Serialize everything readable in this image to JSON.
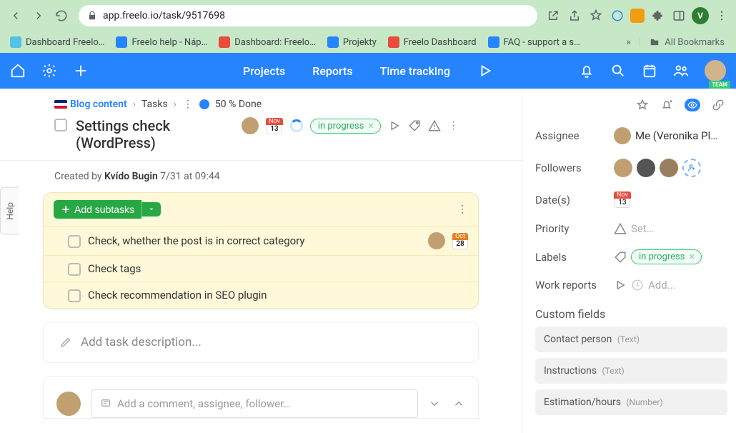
{
  "browser": {
    "url": "app.freelo.io/task/9517698",
    "avatar_letter": "V",
    "bookmarks": [
      {
        "label": "Dashboard Freelo…",
        "fav": "#2684ff"
      },
      {
        "label": "Freelo help - Náp…",
        "fav": "#2684ff"
      },
      {
        "label": "Dashboard: Freelo…",
        "fav": "#e74c3c"
      },
      {
        "label": "Projekty",
        "fav": "#2684ff"
      },
      {
        "label": "Freelo Dashboard",
        "fav": "#e74c3c"
      },
      {
        "label": "FAQ - support a s…",
        "fav": "#2684ff"
      }
    ],
    "bookmarks_overflow": "»",
    "all_bookmarks": "All Bookmarks"
  },
  "appbar": {
    "nav": [
      "Projects",
      "Reports",
      "Time tracking"
    ],
    "team_badge": "TEAM"
  },
  "breadcrumb": {
    "project": "Blog content",
    "section": "Tasks",
    "progress": "50 % Done"
  },
  "task": {
    "title": "Settings check (WordPress)",
    "date_month": "Nov",
    "date_day": "13",
    "label": "in progress",
    "created_prefix": "Created by ",
    "created_author": "Kvído Bugin",
    "created_time": "7/31 at 09:44"
  },
  "subtasks": {
    "add_label": "Add subtasks",
    "items": [
      {
        "title": "Check, whether the post is in correct category",
        "assignee": true,
        "date_month": "Oct",
        "date_day": "28"
      },
      {
        "title": "Check tags"
      },
      {
        "title": "Check recommendation in SEO plugin"
      }
    ]
  },
  "description_placeholder": "Add task description...",
  "comment_placeholder": "Add a comment, assignee, follower…",
  "help": "Help",
  "sidebar": {
    "assignee_label": "Assignee",
    "assignee_value": "Me (Veronika Pl…",
    "followers_label": "Followers",
    "dates_label": "Date(s)",
    "date_month": "Nov",
    "date_day": "13",
    "priority_label": "Priority",
    "priority_value": "Set…",
    "labels_label": "Labels",
    "labels_value": "in progress",
    "reports_label": "Work reports",
    "reports_value": "Add...",
    "custom_title": "Custom fields",
    "custom": [
      {
        "name": "Contact person",
        "type": "(Text)"
      },
      {
        "name": "Instructions",
        "type": "(Text)"
      },
      {
        "name": "Estimation/hours",
        "type": "(Number)"
      }
    ]
  }
}
